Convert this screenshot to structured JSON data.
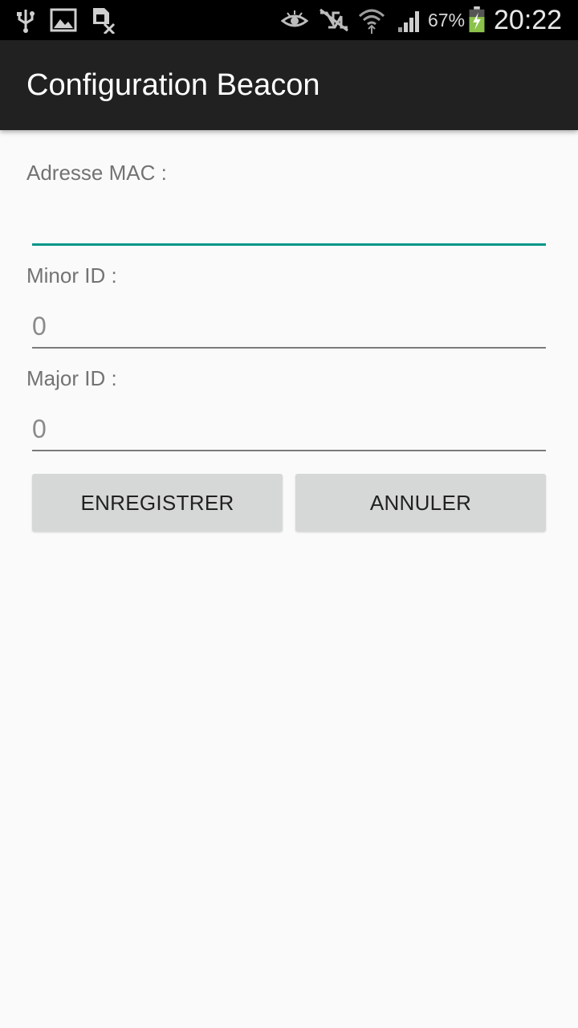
{
  "status_bar": {
    "icons_left": [
      "usb-icon",
      "image-icon",
      "no-sim-icon"
    ],
    "icons_right": [
      "eye-icon",
      "nfc-off-icon",
      "wifi-icon",
      "signal-icon",
      "battery-icon"
    ],
    "battery_percent": "67%",
    "time": "20:22",
    "battery_level": 0.67,
    "battery_color": "#8bc34a"
  },
  "app_bar": {
    "title": "Configuration Beacon"
  },
  "form": {
    "mac_label": "Adresse MAC :",
    "mac_value": "",
    "minor_label": "Minor ID :",
    "minor_value": "0",
    "major_label": "Major ID :",
    "major_value": "0",
    "accent_color": "#009688"
  },
  "buttons": {
    "save": "ENREGISTRER",
    "cancel": "ANNULER"
  }
}
